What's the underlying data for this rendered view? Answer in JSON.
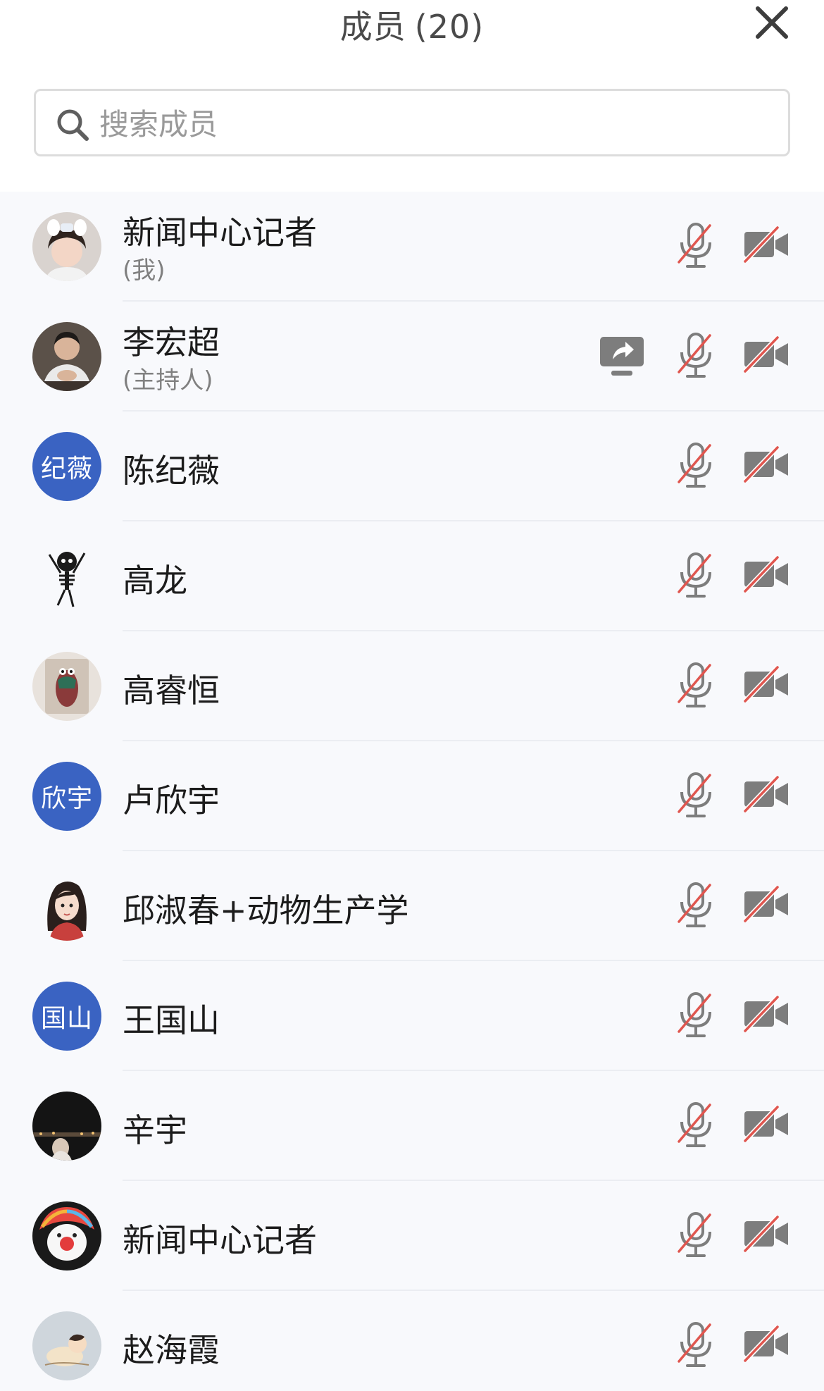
{
  "header": {
    "title": "成员",
    "count": "(20)",
    "close_icon": "close-icon"
  },
  "search": {
    "placeholder": "搜索成员",
    "icon": "search-icon"
  },
  "colors": {
    "text_avatar_bg": "#3a63c2",
    "muted_slash": "#e0564f",
    "icon_gray": "#7d7d7d"
  },
  "members": [
    {
      "name": "新闻中心记者",
      "role": "(我)",
      "avatar": "photo-girl",
      "mic": "mic-off-icon",
      "camera": "camera-off-icon"
    },
    {
      "name": "李宏超",
      "role": "(主持人)",
      "avatar": "photo-man",
      "sharing": "screen-share-icon",
      "mic": "mic-off-icon",
      "camera": "camera-off-icon"
    },
    {
      "name": "陈纪薇",
      "avatar_text": "纪薇",
      "mic": "mic-off-icon",
      "camera": "camera-off-icon"
    },
    {
      "name": "高龙",
      "avatar": "skeleton-sticker",
      "mic": "mic-off-icon",
      "camera": "camera-off-icon"
    },
    {
      "name": "高睿恒",
      "avatar": "photo-toy",
      "mic": "mic-off-icon",
      "camera": "camera-off-icon"
    },
    {
      "name": "卢欣宇",
      "avatar_text": "欣宇",
      "mic": "mic-off-icon",
      "camera": "camera-off-icon"
    },
    {
      "name": "邱淑春+动物生产学",
      "avatar": "cartoon-girl",
      "mic": "mic-off-icon",
      "camera": "camera-off-icon"
    },
    {
      "name": "王国山",
      "avatar_text": "国山",
      "mic": "mic-off-icon",
      "camera": "camera-off-icon"
    },
    {
      "name": "辛宇",
      "avatar": "photo-night",
      "mic": "mic-off-icon",
      "camera": "camera-off-icon"
    },
    {
      "name": "新闻中心记者",
      "avatar": "clown-face",
      "mic": "mic-off-icon",
      "camera": "camera-off-icon"
    },
    {
      "name": "赵海霞",
      "avatar": "cartoon-sleeping",
      "mic": "mic-off-icon",
      "camera": "camera-off-icon"
    }
  ]
}
